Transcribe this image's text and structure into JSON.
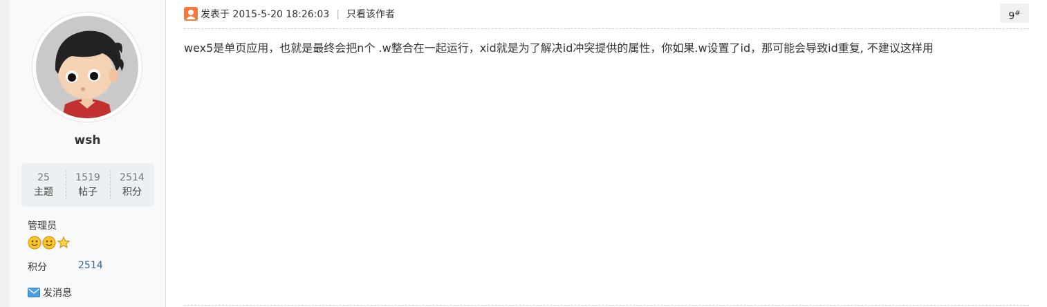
{
  "author": {
    "username": "wsh",
    "stats": [
      {
        "value": "25",
        "label": "主题"
      },
      {
        "value": "1519",
        "label": "帖子"
      },
      {
        "value": "2514",
        "label": "积分"
      }
    ],
    "role": "管理员",
    "medal_icons": [
      "smiley-medal-icon",
      "smiley-medal-icon",
      "star-medal-icon"
    ],
    "points_label": "积分",
    "points_value": "2514",
    "message_label": "发消息"
  },
  "post": {
    "posted_at": "发表于 2015-5-20 18:26:03",
    "separator": "|",
    "author_only_label": "只看该作者",
    "floor_number": "9",
    "floor_suffix": "#",
    "body": "wex5是单页应用，也就是最终会把n个 .w整合在一起运行，xid就是为了解决id冲突提供的属性，你如果.w设置了id，那可能会导致id重复, 不建议这样用"
  },
  "colors": {
    "sidebar_bg": "#f8f9fb",
    "stats_bg": "#edf0f3",
    "link_blue": "#336699",
    "user_icon_orange": "#f07a3c"
  }
}
